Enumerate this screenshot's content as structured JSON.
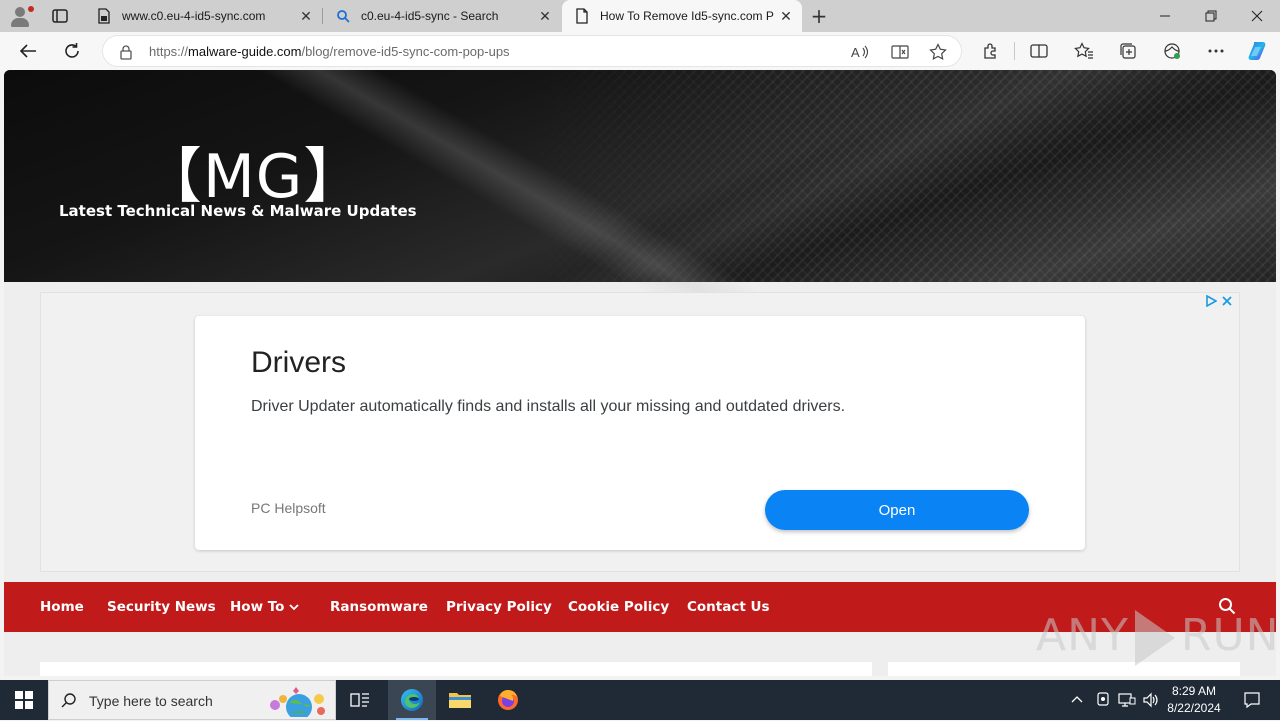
{
  "browser": {
    "tabs": [
      {
        "label": "www.c0.eu-4-id5-sync.com",
        "icon": "page-lock-icon"
      },
      {
        "label": "c0.eu-4-id5-sync - Search",
        "icon": "search-icon"
      },
      {
        "label": "How To Remove Id5-sync.com P",
        "icon": "page-icon"
      }
    ],
    "active_tab": 2,
    "url_prefix": "https://",
    "url_host": "malware-guide.com",
    "url_path": "/blog/remove-id5-sync-com-pop-ups"
  },
  "site": {
    "logo": "【MG】",
    "tagline": "Latest Technical News & Malware Updates",
    "nav": [
      {
        "label": "Home"
      },
      {
        "label": "Security News"
      },
      {
        "label": "How To"
      },
      {
        "label": "Ransomware"
      },
      {
        "label": "Privacy Policy"
      },
      {
        "label": "Cookie Policy"
      },
      {
        "label": "Contact Us"
      }
    ]
  },
  "ad": {
    "title": "Drivers",
    "description": "Driver Updater automatically finds and installs all your missing and outdated drivers.",
    "advertiser": "PC Helpsoft",
    "cta": "Open"
  },
  "watermark": {
    "left": "ANY",
    "right": "RUN"
  },
  "taskbar": {
    "search_placeholder": "Type here to search",
    "time": "8:29 AM",
    "date": "8/22/2024"
  },
  "colors": {
    "nav_red": "#c11a1a",
    "ad_button_blue": "#0a84f4",
    "taskbar": "#1f2a36"
  }
}
